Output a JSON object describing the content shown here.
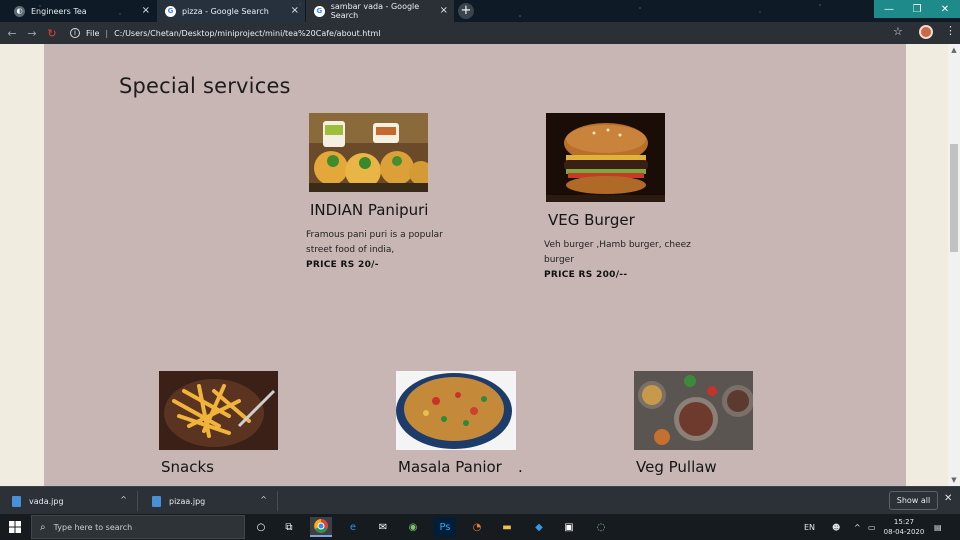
{
  "browser": {
    "tabs": [
      {
        "title": "Engineers Tea",
        "icon": "globe-icon"
      },
      {
        "title": "pizza - Google Search",
        "icon": "google-icon"
      },
      {
        "title": "sambar vada - Google Search",
        "icon": "google-icon"
      }
    ],
    "omnibox": {
      "scheme_label": "File",
      "url": "C:/Users/Chetan/Desktop/miniproject/mini/tea%20Cafe/about.html"
    }
  },
  "page": {
    "heading": "Special services",
    "items": [
      {
        "title": "INDIAN Panipuri",
        "desc": "Framous pani puri is a popular street food of india,",
        "price": "PRICE RS 20/-"
      },
      {
        "title": "VEG Burger",
        "desc": "Veh burger ,Hamb burger, cheez burger",
        "price": "PRICE RS 200/--"
      },
      {
        "title": "Snacks",
        "desc": "",
        "price": ""
      },
      {
        "title": "Masala Panior",
        "suffix": ".",
        "desc": "",
        "price": ""
      },
      {
        "title": "Veg Pullaw",
        "desc": "",
        "price": ""
      }
    ]
  },
  "downloads": {
    "items": [
      {
        "name": "vada.jpg"
      },
      {
        "name": "pizaa.jpg"
      }
    ],
    "show_all": "Show all"
  },
  "taskbar": {
    "search_placeholder": "Type here to search",
    "lang": "EN",
    "time": "15:27",
    "date": "08-04-2020"
  },
  "colors": {
    "page_bg": "#f0ece0",
    "content_bg": "#c7b6b4",
    "chrome_dark": "#2a3036",
    "taskbar": "#161b1f"
  }
}
